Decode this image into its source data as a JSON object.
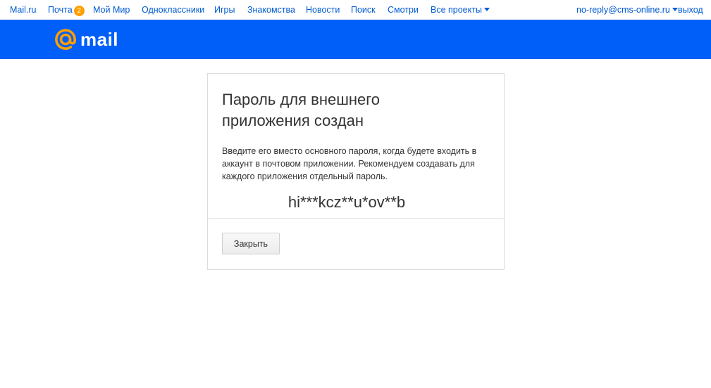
{
  "topbar": {
    "links": {
      "mailru": "Mail.ru",
      "pochta": "Почта",
      "pochta_badge": "2",
      "moi_mir": "Мой Мир",
      "odnoklassniki": "Одноклассники",
      "igry": "Игры",
      "znakomstva": "Знакомства",
      "novosti": "Новости",
      "poisk": "Поиск",
      "smotri": "Смотри",
      "vse_proekty": "Все проекты"
    },
    "user_email": "no-reply@cms-online.ru",
    "logout": "выход"
  },
  "header": {
    "logo_text": "mail"
  },
  "dialog": {
    "title": "Пароль для внешнего приложения создан",
    "description": "Введите его вместо основного пароля, когда будете входить в аккаунт в почтовом приложении. Рекомендуем создавать для каждого приложения отдельный пароль.",
    "password": "hi***kcz**u*ov**b",
    "close_label": "Закрыть"
  },
  "colors": {
    "header_blue": "#005ff9",
    "link_blue": "#005bd1",
    "logo_orange": "#ff9e00",
    "badge_orange": "#ff9e00"
  }
}
